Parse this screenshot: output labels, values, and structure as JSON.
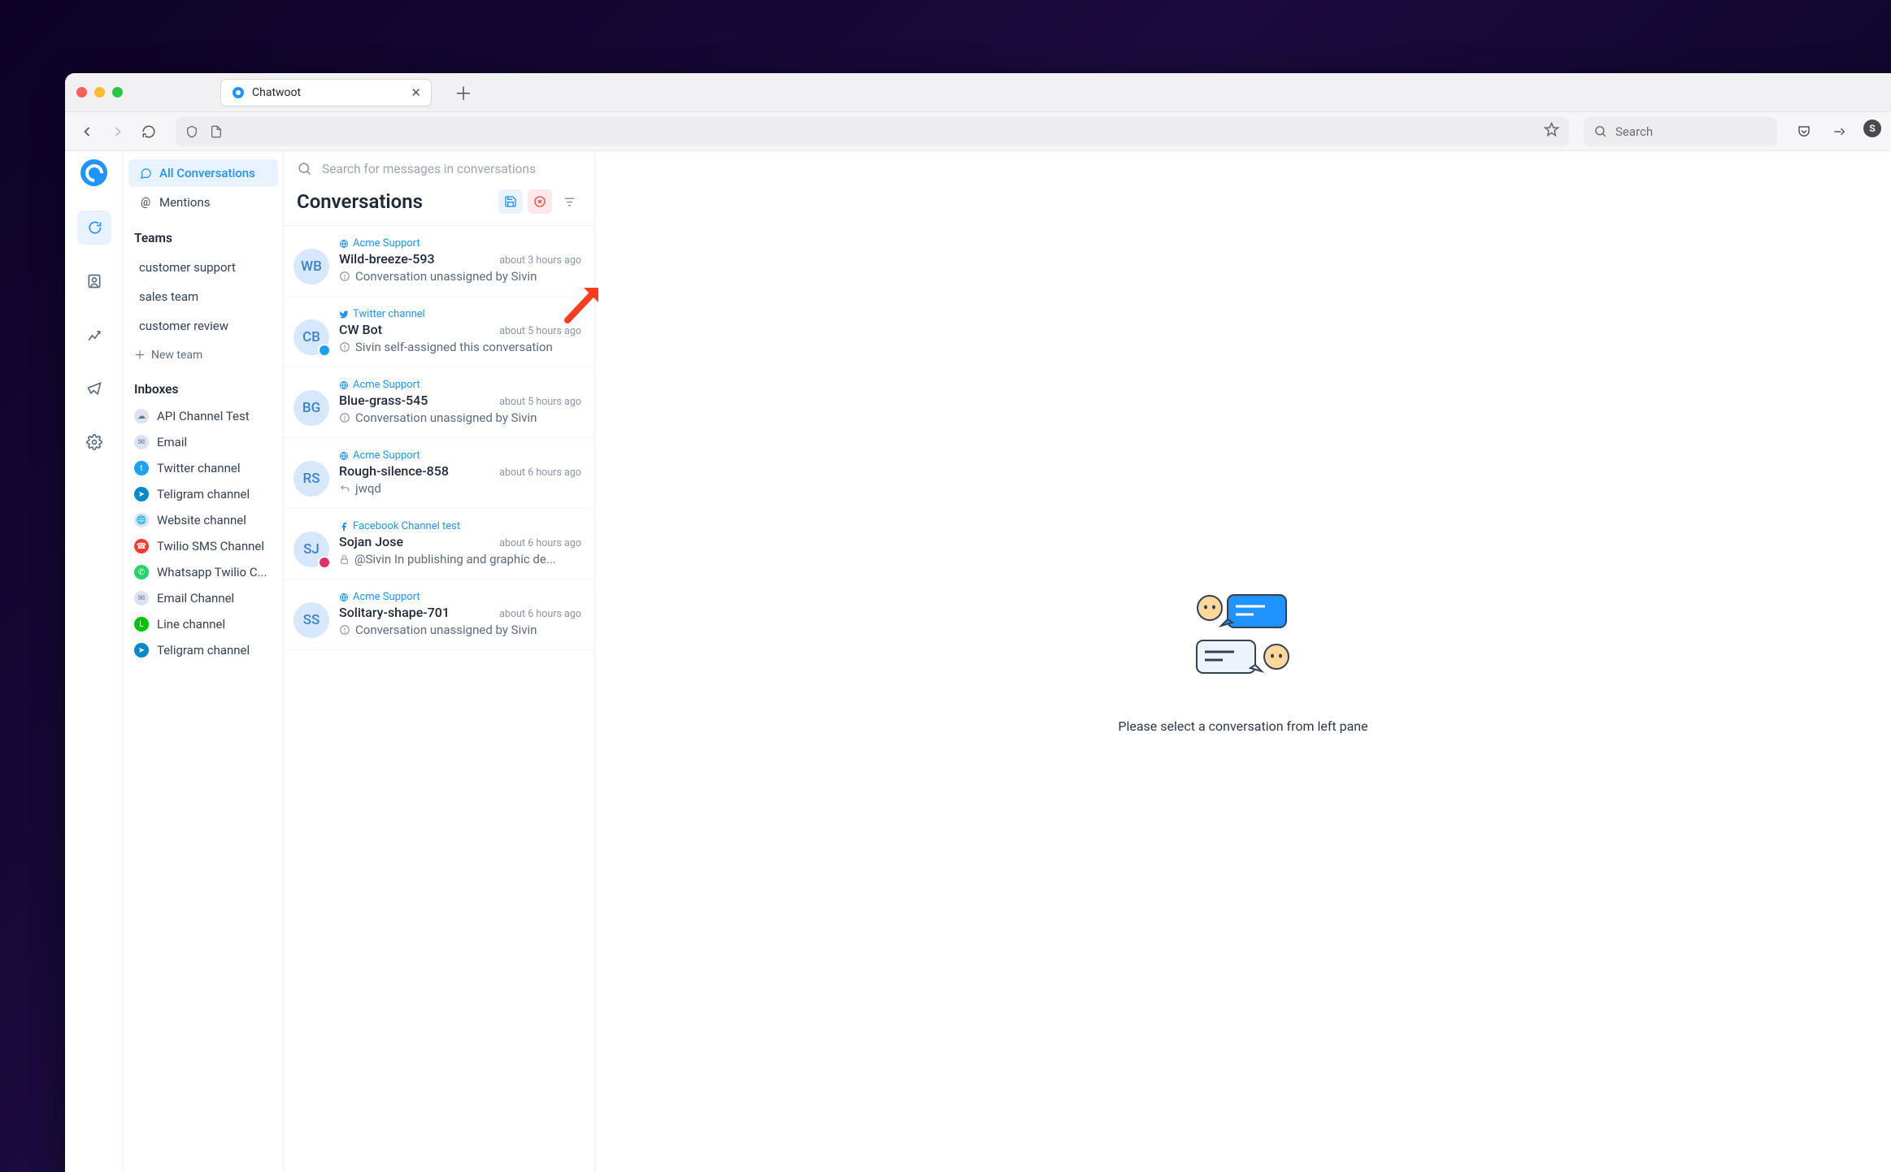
{
  "browser": {
    "tab_title": "Chatwoot",
    "search_placeholder": "Search"
  },
  "rail": {
    "items": [
      "conversations",
      "contacts",
      "reports",
      "campaigns",
      "settings"
    ]
  },
  "sidebar": {
    "nav": [
      {
        "icon": "chat",
        "label": "All Conversations",
        "active": true
      },
      {
        "icon": "at",
        "label": "Mentions",
        "active": false
      }
    ],
    "teams_head": "Teams",
    "teams": [
      "customer support",
      "sales team",
      "customer review"
    ],
    "new_team": "New team",
    "inboxes_head": "Inboxes",
    "inboxes": [
      {
        "icon": "cloud",
        "label": "API Channel Test"
      },
      {
        "icon": "mail",
        "label": "Email"
      },
      {
        "icon": "tw",
        "label": "Twitter channel"
      },
      {
        "icon": "tg",
        "label": "Teligram channel"
      },
      {
        "icon": "globe",
        "label": "Website channel"
      },
      {
        "icon": "sms",
        "label": "Twilio SMS Channel"
      },
      {
        "icon": "wa",
        "label": "Whatsapp Twilio C..."
      },
      {
        "icon": "mail",
        "label": "Email Channel"
      },
      {
        "icon": "line",
        "label": "Line channel"
      },
      {
        "icon": "tg",
        "label": "Teligram channel"
      }
    ]
  },
  "mid": {
    "search_placeholder": "Search for messages in conversations",
    "title": "Conversations",
    "conversations": [
      {
        "avatar": "WB",
        "channel_icon": "globe",
        "channel": "Acme Support",
        "name": "Wild-breeze-593",
        "time": "about 3 hours ago",
        "snip_icon": "info",
        "snippet": "Conversation unassigned by Sivin"
      },
      {
        "avatar": "CB",
        "badge": "tw",
        "channel_icon": "tw",
        "channel": "Twitter channel",
        "name": "CW Bot",
        "time": "about 5 hours ago",
        "snip_icon": "info",
        "snippet": "Sivin self-assigned this conversation"
      },
      {
        "avatar": "BG",
        "channel_icon": "globe",
        "channel": "Acme Support",
        "name": "Blue-grass-545",
        "time": "about 5 hours ago",
        "snip_icon": "info",
        "snippet": "Conversation unassigned by Sivin"
      },
      {
        "avatar": "RS",
        "channel_icon": "globe",
        "channel": "Acme Support",
        "name": "Rough-silence-858",
        "time": "about 6 hours ago",
        "snip_icon": "reply",
        "snippet": "jwqd"
      },
      {
        "avatar": "SJ",
        "badge": "fb",
        "channel_icon": "fb",
        "channel": "Facebook Channel test",
        "name": "Sojan Jose",
        "time": "about 6 hours ago",
        "snip_icon": "lock",
        "snippet": "@Sivin In publishing and graphic de..."
      },
      {
        "avatar": "SS",
        "channel_icon": "globe",
        "channel": "Acme Support",
        "name": "Solitary-shape-701",
        "time": "about 6 hours ago",
        "snip_icon": "info",
        "snippet": "Conversation unassigned by Sivin"
      }
    ]
  },
  "main": {
    "placeholder": "Please select a conversation from left pane"
  }
}
